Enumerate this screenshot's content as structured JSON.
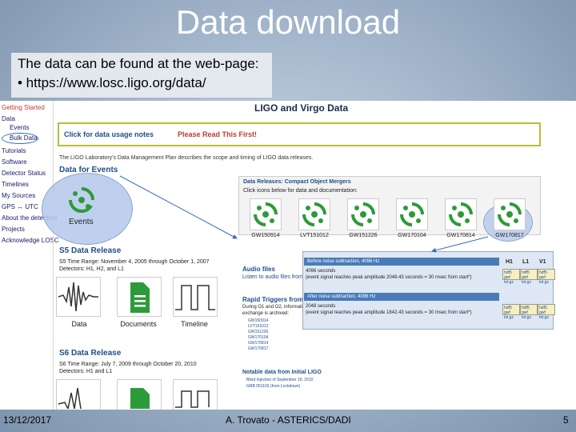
{
  "slide": {
    "title": "Data download",
    "intro": "The data can be found at the web-page:",
    "bullet": "•  https://www.losc.ligo.org/data/"
  },
  "sidebar": {
    "items": [
      "Getting Started",
      "Data",
      "Events",
      "Bulk Data",
      "Tutorials",
      "Software",
      "Detector Status",
      "Timelines",
      "My Sources",
      "GPS ↔ UTC",
      "About the detectors",
      "Projects",
      "Acknowledge LOSC"
    ]
  },
  "page": {
    "heading": "LIGO and Virgo Data",
    "notes_left": "Click for data usage notes",
    "notes_right": "Please Read This First!",
    "dmp_line": "The LIGO Laboratory's Data Management Plan describes the scope and timing of LIGO data releases.",
    "events_heading": "Data for Events",
    "events_label": "Events",
    "s5": {
      "heading": "S5 Data Release",
      "range": "S5 Time Range: November 4, 2005 through October 1, 2007",
      "detectors": "Detectors: H1, H2, and L1",
      "thumbs": [
        "Data",
        "Documents",
        "Timeline"
      ]
    },
    "s6": {
      "heading": "S6 Data Release",
      "range": "S6 Time Range: July 7, 2009 through October 20, 2010",
      "detectors": "Detectors: H1 and L1"
    },
    "mergers": {
      "heading": "Data Releases: Compact Object Mergers",
      "sub": "Click icons below for data and documentation:",
      "events": [
        "GW150914",
        "LVT151012",
        "GW151226",
        "GW170104",
        "GW170814",
        "GW170817"
      ]
    },
    "audio": {
      "heading": "Audio files",
      "link": "Listen to audio files from L"
    },
    "rapid": {
      "heading": "Rapid Triggers from",
      "text1": "During O1 and O2, information",
      "text2": "exchange is archived:",
      "list": [
        "GW150914",
        "LVT151012",
        "GW151226",
        "GW170104",
        "GW170814",
        "GW170817"
      ]
    },
    "notable": {
      "heading": "Notable data from Initial LIGO",
      "item1": "Blind Injection of September 16, 2010",
      "item2": "GRB 051103 (from Lockdown)"
    },
    "noise": {
      "head1": "Before noise subtraction, 4096 Hz",
      "line1a": "4096 seconds",
      "line1b": "(event signal reaches peak amplitude 2048.43 seconds = 30 msec from start*)",
      "head2": "After noise subtraction, 4096 Hz",
      "line2a": "2048 seconds",
      "line2b": "(event signal reaches peak amplitude 1842.43 seconds = 30 msec from start*)",
      "cols": [
        "H1",
        "L1",
        "V1"
      ],
      "cells1": [
        "hdf5 gwf txt.gz",
        "hdf5 gwf txt.gz",
        "hdf5 gwf txt.gz"
      ],
      "cells2": [
        "hdf5 gwf txt.gz",
        "hdf5 gwf txt.gz",
        "hdf5 gwf txt.gz"
      ]
    }
  },
  "footer": {
    "date": "13/12/2017",
    "author": "A. Trovato - ASTERICS/DADI",
    "page": "5"
  },
  "colors": {
    "accent_blue": "#1f4e8a",
    "warning_red": "#c0392b",
    "logo_green": "#2d9a3a"
  }
}
